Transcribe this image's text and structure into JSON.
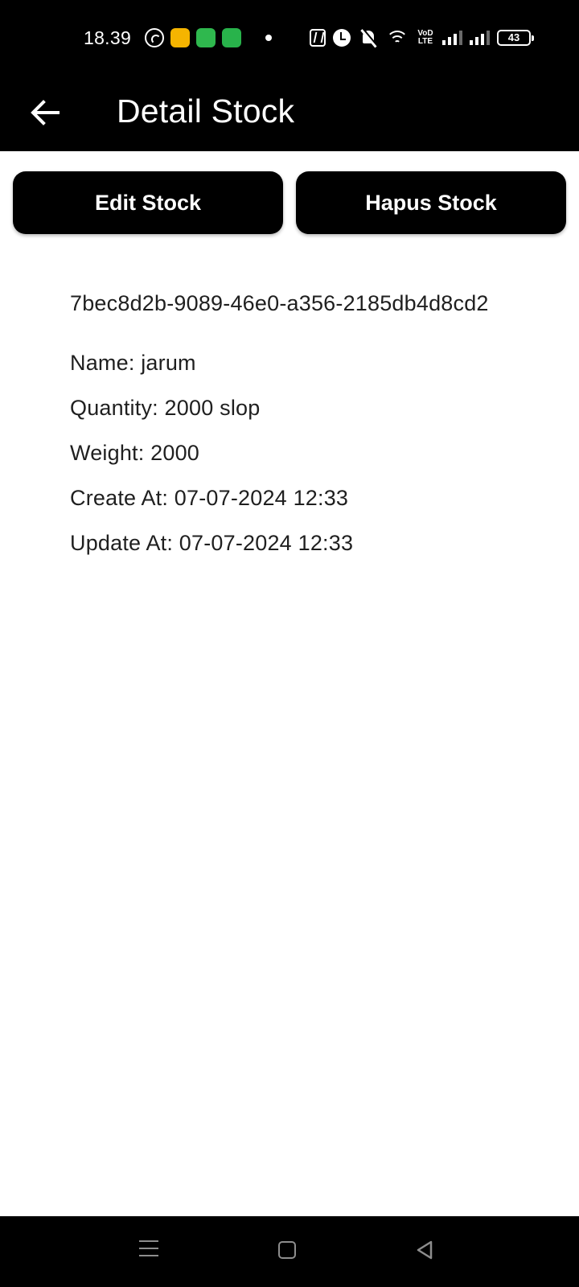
{
  "status_bar": {
    "time": "18.39",
    "battery": "43",
    "volte": "VoD LTE",
    "icons": [
      "whatsapp-icon",
      "app-notification-icon",
      "sim-icon",
      "chat-icon",
      "dot-icon",
      "nfc-icon",
      "alarm-icon",
      "mute-icon",
      "wifi-icon",
      "volte-icon",
      "signal-icon",
      "battery-icon"
    ],
    "colors": {
      "background": "#000000",
      "foreground": "#ffffff"
    }
  },
  "app_bar": {
    "title": "Detail Stock",
    "back_icon": "arrow-left-icon"
  },
  "actions": {
    "edit_label": "Edit Stock",
    "delete_label": "Hapus Stock"
  },
  "stock": {
    "id": "7bec8d2b-9089-46e0-a356-2185db4d8cd2",
    "name": "Name: jarum",
    "quantity": "Quantity: 2000 slop",
    "weight": "Weight: 2000",
    "created_at": "Create At: 07-07-2024 12:33",
    "updated_at": "Update At: 07-07-2024 12:33"
  },
  "nav_bar": {
    "icons": [
      "menu-icon",
      "home-icon",
      "back-icon"
    ]
  },
  "theme": {
    "primary": "#000000",
    "on_primary": "#ffffff",
    "surface": "#ffffff",
    "text": "#1f1f1f"
  }
}
